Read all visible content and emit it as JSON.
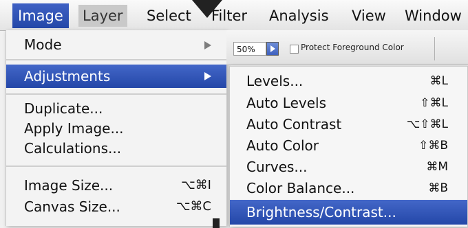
{
  "menubar": {
    "items": [
      "Image",
      "Layer",
      "Select",
      "Filter",
      "Analysis",
      "View",
      "Window"
    ]
  },
  "image_menu": {
    "mode_label": "Mode",
    "adjustments_label": "Adjustments",
    "duplicate_label": "Duplicate...",
    "apply_image_label": "Apply Image...",
    "calculations_label": "Calculations...",
    "image_size_label": "Image Size...",
    "image_size_shortcut": "⌥⌘I",
    "canvas_size_label": "Canvas Size...",
    "canvas_size_shortcut": "⌥⌘C"
  },
  "options_bar": {
    "zoom_value": "50%",
    "protect_label": "Protect Foreground Color"
  },
  "adjustments_menu": {
    "items": [
      {
        "label": "Levels...",
        "shortcut": "⌘L"
      },
      {
        "label": "Auto Levels",
        "shortcut": "⇧⌘L"
      },
      {
        "label": "Auto Contrast",
        "shortcut": "⌥⇧⌘L"
      },
      {
        "label": "Auto Color",
        "shortcut": "⇧⌘B"
      },
      {
        "label": "Curves...",
        "shortcut": "⌘M"
      },
      {
        "label": "Color Balance...",
        "shortcut": "⌘B"
      },
      {
        "label": "Brightness/Contrast...",
        "shortcut": ""
      }
    ]
  },
  "colors": {
    "highlight": "#2f52b5"
  }
}
